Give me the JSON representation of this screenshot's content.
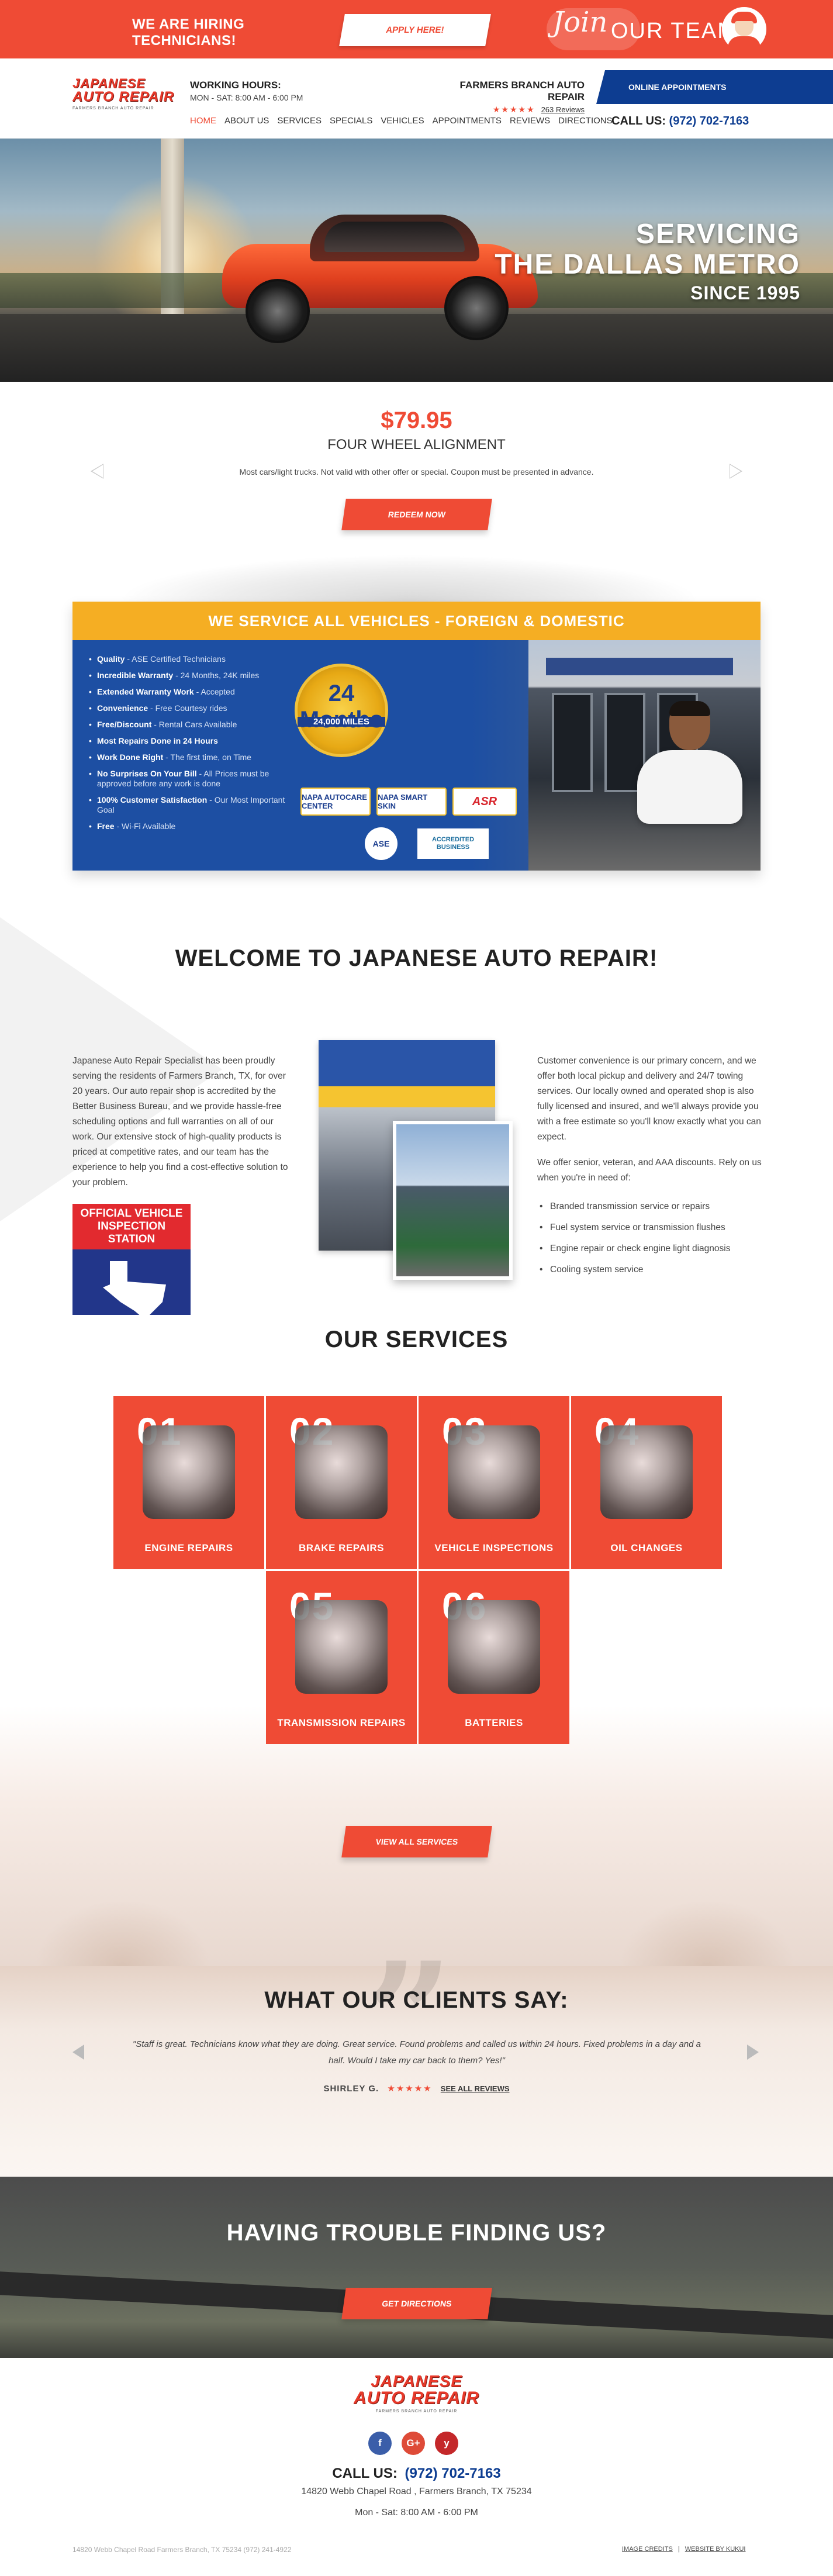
{
  "hiring": {
    "headline_line1": "WE ARE HIRING",
    "headline_line2": "TECHNICIANS!",
    "apply_label": "APPLY HERE!",
    "join_script": "Join",
    "join_team": "OUR TEAM"
  },
  "header": {
    "logo_line1": "JAPANESE",
    "logo_line2": "AUTO REPAIR",
    "logo_tagline": "FARMERS BRANCH AUTO REPAIR",
    "hours_label": "WORKING HOURS:",
    "hours_value": "MON - SAT: 8:00 AM - 6:00 PM",
    "shop_name": "FARMERS BRANCH AUTO REPAIR",
    "stars": "★★★★★",
    "reviews_link": "263 Reviews",
    "online_label": "ONLINE APPOINTMENTS",
    "call_label": "CALL US:",
    "phone": "(972) 702-7163",
    "nav": [
      "HOME",
      "ABOUT US",
      "SERVICES",
      "SPECIALS",
      "VEHICLES",
      "APPOINTMENTS",
      "REVIEWS",
      "DIRECTIONS"
    ]
  },
  "hero": {
    "line1": "SERVICING",
    "line2": "THE DALLAS METRO",
    "line3": "SINCE 1995"
  },
  "coupon": {
    "price": "$79.95",
    "title": "FOUR WHEEL ALIGNMENT",
    "note": "Most cars/light trucks. Not valid with other offer or special. Coupon must be presented in advance.",
    "redeem_label": "REDEEM NOW"
  },
  "vehicles": {
    "headline": "WE SERVICE ALL VEHICLES - FOREIGN & DOMESTIC",
    "features": [
      {
        "title": "Quality",
        "detail": " - ASE Certified Technicians"
      },
      {
        "title": "Incredible Warranty",
        "detail": " - 24 Months, 24K miles"
      },
      {
        "title": "Extended Warranty Work",
        "detail": " - Accepted"
      },
      {
        "title": "Convenience",
        "detail": " - Free Courtesy rides"
      },
      {
        "title": "Free/Discount",
        "detail": " - Rental Cars Available"
      },
      {
        "title": "Most Repairs Done in 24 Hours",
        "detail": ""
      },
      {
        "title": "Work Done Right",
        "detail": " - The first time, on Time"
      },
      {
        "title": "No Surprises On Your Bill",
        "detail": " - All Prices must be approved before any work is done"
      },
      {
        "title": "100% Customer Satisfaction",
        "detail": " - Our Most Important Goal"
      },
      {
        "title": "Free",
        "detail": " - Wi-Fi Available"
      }
    ],
    "warranty_months": "24 Months",
    "warranty_miles": "24,000 MILES",
    "badge_autocare": "NAPA AUTOCARE CENTER",
    "badge_smartskin": "NAPA SMART SKIN",
    "badge_asr": "ASR",
    "badge_ase": "ASE",
    "badge_bbb": "ACCREDITED BUSINESS"
  },
  "welcome": {
    "title": "WELCOME TO JAPANESE AUTO REPAIR!",
    "left_text": "Japanese Auto Repair Specialist has been proudly serving the residents of Farmers Branch, TX, for over 20 years. Our auto repair shop is accredited by the Better Business Bureau, and we provide hassle-free scheduling options and full warranties on all of our work. Our extensive stock of high-quality products is priced at competitive rates, and our team has the experience to help you find a cost-effective solution to your problem.",
    "inspection_line1": "OFFICIAL VEHICLE",
    "inspection_line2": "INSPECTION STATION",
    "right_p1": "Customer convenience is our primary concern, and we offer both local pickup and delivery and 24/7 towing services. Our locally owned and operated shop is also fully licensed and insured, and we'll always provide you with a free estimate so you'll know exactly what you can expect.",
    "right_p2": "We offer senior, veteran, and AAA discounts. Rely on us when you're in need of:",
    "needs": [
      "Branded transmission service or repairs",
      "Fuel system service or transmission flushes",
      "Engine repair or check engine light diagnosis",
      "Cooling system service"
    ]
  },
  "services": {
    "title": "OUR SERVICES",
    "cards": [
      {
        "num": "01",
        "label": "ENGINE REPAIRS"
      },
      {
        "num": "02",
        "label": "BRAKE REPAIRS"
      },
      {
        "num": "03",
        "label": "VEHICLE INSPECTIONS"
      },
      {
        "num": "04",
        "label": "OIL CHANGES"
      },
      {
        "num": "05",
        "label": "TRANSMISSION REPAIRS"
      },
      {
        "num": "06",
        "label": "BATTERIES"
      }
    ],
    "view_all_label": "VIEW ALL SERVICES"
  },
  "testimonial": {
    "title": "WHAT OUR CLIENTS SAY:",
    "quote": "\"Staff is great. Technicians know what they are doing. Great service. Found problems and called us within 24 hours. Fixed problems in a day and a half. Would I take my car back to them? Yes!\"",
    "author": "SHIRLEY G.",
    "stars": "★★★★★",
    "see_all": "SEE ALL REVIEWS"
  },
  "directions": {
    "title": "HAVING TROUBLE FINDING US?",
    "button_label": "GET DIRECTIONS"
  },
  "footer": {
    "logo_line1": "JAPANESE",
    "logo_line2": "AUTO REPAIR",
    "logo_tagline": "FARMERS BRANCH AUTO REPAIR",
    "social_fb": "f",
    "social_gp": "G+",
    "social_yelp": "y",
    "call_label": "CALL US:",
    "phone": "(972) 702-7163",
    "address": "14820 Webb Chapel Road , Farmers Branch, TX 75234",
    "hours": "Mon - Sat: 8:00 AM - 6:00 PM",
    "bottom_line": "14820 Webb Chapel Road Farmers Branch, TX 75234 (972) 241-4922",
    "image_credits": "IMAGE CREDITS",
    "separator": "|",
    "website_by": "WEBSITE BY KUKUI"
  },
  "colors": {
    "accent_red": "#ef4b35",
    "brand_blue": "#0d3d91",
    "banner_yellow": "#f5ae23"
  }
}
